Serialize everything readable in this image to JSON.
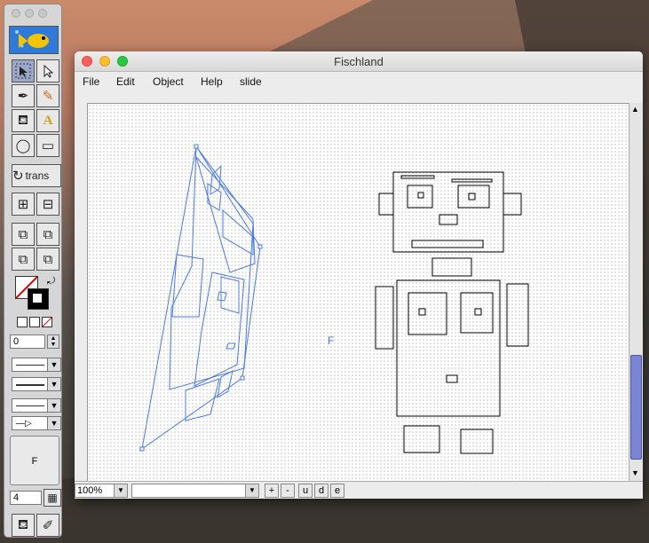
{
  "window": {
    "title": "Fischland"
  },
  "menu": [
    "File",
    "Edit",
    "Object",
    "Help",
    "slide"
  ],
  "palette": {
    "tools": [
      "select-tool",
      "direct-select-tool",
      "pen-tool",
      "pencil-tool",
      "paint-bucket-tool",
      "text-tool",
      "ellipse-tool",
      "rectangle-tool"
    ],
    "trans_label": "trans",
    "stroke_width_value": "0",
    "font_button_label": "F",
    "grid_value": "4"
  },
  "canvas": {
    "marker_text": "F"
  },
  "bottom": {
    "zoom": "100%",
    "buttons": [
      "+",
      "-",
      "u",
      "d",
      "e"
    ]
  },
  "colors": {
    "accent_blue": "#4a7ae0",
    "selected_tool": "#9aa7c9",
    "robot_stroke": "#000000"
  }
}
